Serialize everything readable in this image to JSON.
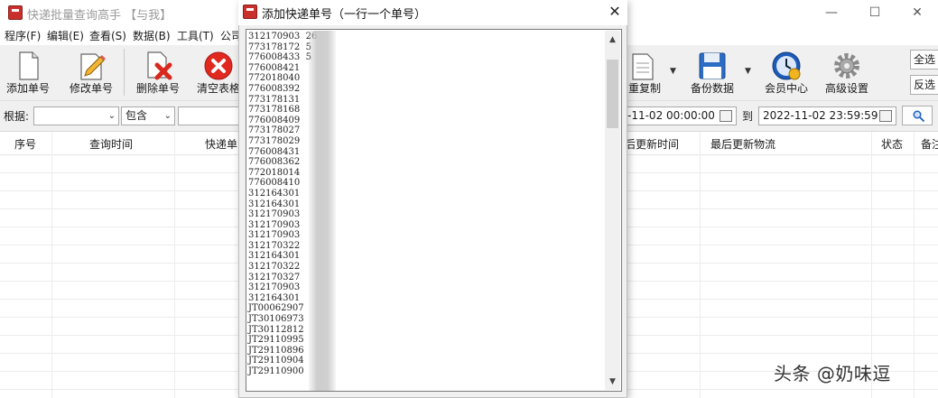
{
  "main_window": {
    "title": "快递批量查询高手 【与我】",
    "controls": {
      "minimize": "—",
      "maximize": "☐",
      "close": "✕"
    },
    "menu": [
      "程序(F)",
      "编辑(E)",
      "查看(S)",
      "数据(B)",
      "工具(T)",
      "公司"
    ],
    "toolbar": {
      "add": "添加单号",
      "edit": "修改单号",
      "delete": "删除单号",
      "clear": "清空表格",
      "copy": "重复制",
      "backup": "备份数据",
      "member": "会员中心",
      "settings": "高级设置",
      "select_all": "全选",
      "invert": "反选"
    },
    "filter": {
      "label": "根据:",
      "field_value": "",
      "match_value": "包含",
      "keyword": "",
      "date_from": "-11-02 00:00:00",
      "to_label": "到",
      "date_to": "2022-11-02 23:59:59"
    },
    "columns": [
      "序号",
      "查询时间",
      "快递单",
      "后更新时间",
      "最后更新物流",
      "状态",
      "备注"
    ]
  },
  "dialog": {
    "title": "添加快递单号（一行一个单号）",
    "close": "✕",
    "tracking_numbers": [
      "312170903  26",
      "773178172  5",
      "776008433  5",
      "776008421",
      "772018040",
      "776008392",
      "773178131",
      "773178168",
      "776008409",
      "773178027",
      "773178029",
      "776008431",
      "776008362",
      "772018014",
      "776008410",
      "312164301",
      "312164301",
      "312170903",
      "312170903",
      "312170903",
      "312170322",
      "312164301",
      "312170322",
      "312170327",
      "312170903",
      "312164301",
      "JT00062907",
      "JT30106973",
      "JT30112812",
      "JT29110995",
      "JT29110896",
      "JT29110904",
      "JT29110900"
    ]
  },
  "watermark": "头条 @奶味逗",
  "colors": {
    "accent_blue": "#2b6cc4",
    "delete_red": "#d9281e",
    "title_gray": "#9a9a9a"
  }
}
